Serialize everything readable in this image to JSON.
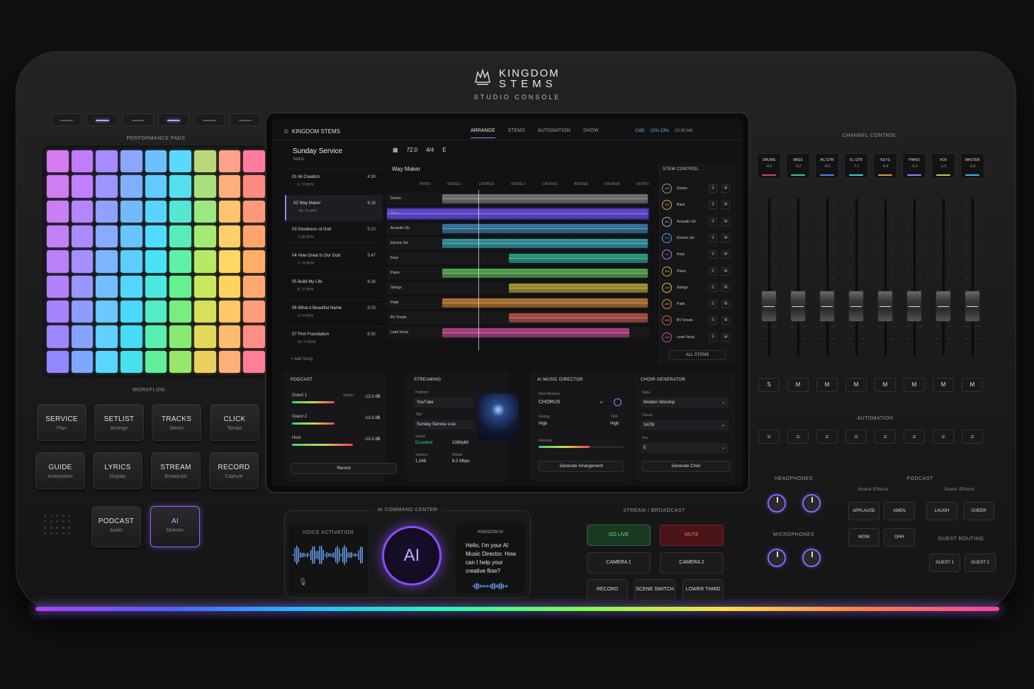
{
  "brand": {
    "name_line1": "KINGDOM",
    "name_line2": "STEMS",
    "subtitle": "STUDIO CONSOLE"
  },
  "labels": {
    "performance_pads": "PERFORMANCE PADS",
    "workflow": "WORKFLOW",
    "channel_control": "CHANNEL CONTROL",
    "automation": "AUTOMATION",
    "headphones": "HEADPHONES",
    "microphones": "MICROPHONES",
    "podcast": "PODCAST",
    "sound_effects": "Sound Effects",
    "guest_effects": "Guest Effects",
    "guest_routing": "GUEST ROUTING",
    "ai_command_center": "AI COMMAND CENTER",
    "stream_broadcast": "STREAM / BROADCAST",
    "voice_activation": "VOICE ACTIVATION"
  },
  "pad_colors": [
    [
      "#d67cf0",
      "#c07cff",
      "#a58cff",
      "#8aa6ff",
      "#6dc0ff",
      "#5ad8ff",
      "#b9d778",
      "#ffa28a",
      "#ff7c9e"
    ],
    [
      "#d07cf2",
      "#c080ff",
      "#9a95ff",
      "#7eb0ff",
      "#62caff",
      "#55e0f0",
      "#a7e07c",
      "#ffb07a",
      "#ff8a80"
    ],
    [
      "#c97ef4",
      "#b585ff",
      "#92a0ff",
      "#72baff",
      "#58d4ff",
      "#55e6d4",
      "#9be880",
      "#ffc470",
      "#ff9878"
    ],
    [
      "#c27ff6",
      "#ab8aff",
      "#88aaff",
      "#66c4ff",
      "#50dcff",
      "#58ecbc",
      "#a4ea74",
      "#ffd06a",
      "#ffa46e"
    ],
    [
      "#ba80f8",
      "#a290ff",
      "#7eb4ff",
      "#5ccdff",
      "#4ce2f6",
      "#5ef0a4",
      "#b6ea66",
      "#ffd864",
      "#ffae66"
    ],
    [
      "#b282fa",
      "#9996ff",
      "#74beff",
      "#52d6ff",
      "#4ce8e0",
      "#66f090",
      "#c8e65e",
      "#ffd262",
      "#ffa870"
    ],
    [
      "#a884fc",
      "#8f9cff",
      "#6ac8ff",
      "#4ad8ff",
      "#52ecc8",
      "#76ee80",
      "#d6e05a",
      "#ffc866",
      "#ff9c7c"
    ],
    [
      "#9e86fe",
      "#86a2ff",
      "#60d0ff",
      "#46dcf8",
      "#5aeeb0",
      "#88ea74",
      "#e2d85a",
      "#ffbc6e",
      "#ff8e88"
    ],
    [
      "#9488ff",
      "#7ca8ff",
      "#58d6ff",
      "#48e0ea",
      "#62ee9a",
      "#98e66c",
      "#ead05e",
      "#ffb078",
      "#ff8094"
    ]
  ],
  "mode_strip": [
    false,
    true,
    false,
    true,
    false,
    false
  ],
  "workflow": [
    {
      "t": "SERVICE",
      "s": "Plan"
    },
    {
      "t": "SETLIST",
      "s": "Arrange"
    },
    {
      "t": "TRACKS",
      "s": "Stems"
    },
    {
      "t": "CLICK",
      "s": "Tempo"
    },
    {
      "t": "GUIDE",
      "s": "Automation"
    },
    {
      "t": "LYRICS",
      "s": "Display"
    },
    {
      "t": "STREAM",
      "s": "Broadcast"
    },
    {
      "t": "RECORD",
      "s": "Capture"
    },
    {
      "t": "PODCAST",
      "s": "Audio"
    },
    {
      "t": "AI",
      "s": "Director"
    }
  ],
  "screen": {
    "app_name": "KINGDOM STEMS",
    "tabs": [
      "ARRANGE",
      "STEMS",
      "AUTOMATION",
      "SHOW"
    ],
    "active_tab": 0,
    "status": {
      "cpu": "CPU 23%",
      "time": "10:30 AM",
      "net": "CMD"
    },
    "transport": {
      "tempo": "72.0",
      "meter": "4/4",
      "key": "E"
    },
    "setlist_title": "Sunday Service",
    "setlist_sub": "Setlist",
    "songs": [
      {
        "nm": "01  All Creation",
        "meta": "E  72 BPM",
        "dur": "4:30"
      },
      {
        "nm": "02  Way Maker",
        "meta": "Bb  76 BPM",
        "dur": "6:18"
      },
      {
        "nm": "03  Goodness of God",
        "meta": "C  68 BPM",
        "dur": "5:22"
      },
      {
        "nm": "04  How Great Is Our God",
        "meta": "D  74 BPM",
        "dur": "5:47"
      },
      {
        "nm": "05  Build My Life",
        "meta": "B  72 BPM",
        "dur": "6:16"
      },
      {
        "nm": "06  What A Beautiful Name",
        "meta": "A  70 BPM",
        "dur": "5:03"
      },
      {
        "nm": "07  Firm Foundation",
        "meta": "Eb  70 BPM",
        "dur": "6:32"
      }
    ],
    "active_song": 1,
    "add_song": "+ Add Song",
    "arrange_song": "Way Maker",
    "sections": [
      "INTRO",
      "VERSE 1",
      "CHORUS",
      "VERSE 2",
      "CHORUS",
      "BRIDGE",
      "CHORUS",
      "OUTRO"
    ],
    "tracks": [
      {
        "name": "Drums",
        "color": "#8a8a8a"
      },
      {
        "name": "Bass",
        "color": "#6b4fd8"
      },
      {
        "name": "Acoustic Gtr",
        "color": "#3d8fc4"
      },
      {
        "name": "Electric Gtr",
        "color": "#36b4c4"
      },
      {
        "name": "Keys",
        "color": "#2fbf9c"
      },
      {
        "name": "Piano",
        "color": "#5fc75a"
      },
      {
        "name": "Strings",
        "color": "#c9b533"
      },
      {
        "name": "Pads",
        "color": "#d9892f"
      },
      {
        "name": "BV Vocals",
        "color": "#d45a4f"
      },
      {
        "name": "Lead Vocal",
        "color": "#d64a9a"
      }
    ],
    "stem_control_title": "STEM CONTROL",
    "stems": [
      {
        "db": "-6.6",
        "name": "Drums",
        "color": "#9a9a9a"
      },
      {
        "db": "-3.2",
        "name": "Bass",
        "color": "#e2a43a"
      },
      {
        "db": "-6.0",
        "name": "Acoustic Gtr",
        "color": "#aaa"
      },
      {
        "db": "-7.1",
        "name": "Electric Gtr",
        "color": "#4aa8ff"
      },
      {
        "db": "-∞",
        "name": "Keys",
        "color": "#b07cff"
      },
      {
        "db": "-5.4",
        "name": "Piano",
        "color": "#e2a43a"
      },
      {
        "db": "-1.0",
        "name": "Strings",
        "color": "#e2c43a"
      },
      {
        "db": "-8.5",
        "name": "Pads",
        "color": "#e28a3a"
      },
      {
        "db": "-2.8",
        "name": "BV Vocals",
        "color": "#e2543a"
      },
      {
        "db": "-1.2",
        "name": "Lead Vocal",
        "color": "#d64a9a"
      }
    ],
    "solo_label": "S",
    "mute_label": "M",
    "all_stems": "ALL STEMS",
    "podcast": {
      "title": "PODCAST",
      "rows": [
        {
          "name": "Guest 1",
          "tag": "Switch",
          "db": "-12.0 dB"
        },
        {
          "name": "Guest 2",
          "tag": "",
          "db": "-12.0 dB"
        },
        {
          "name": "Host",
          "tag": "",
          "db": "-12.0 dB"
        }
      ],
      "record": "Record"
    },
    "streaming": {
      "title": "STREAMING",
      "platform_label": "Platform",
      "platform": "YouTube",
      "title_label": "Title",
      "title_value": "Sunday Service Live",
      "status_label": "Status",
      "status": "Excellent",
      "resolution": "1080p60",
      "viewers_label": "Viewers",
      "viewers": "1,248",
      "bitrate_label": "Bitrate",
      "bitrate": "8.2 Mbps"
    },
    "ai_director": {
      "title": "AI MUSIC DIRECTOR",
      "next_label": "Next Moment",
      "next": "CHORUS",
      "energy_label": "Energy",
      "energy": "High",
      "energy_right": "High",
      "energy_right_label": "N/A",
      "intensity_label": "Intensity",
      "intensity_level": 0.6,
      "button": "Generate Arrangement"
    },
    "choir": {
      "title": "CHOIR GENERATOR",
      "style_label": "Style",
      "style": "Modern Worship",
      "voices_label": "Voices",
      "voices": "SATB",
      "key_label": "Key",
      "key": "E",
      "button": "Generate Choir"
    }
  },
  "ai_center": {
    "orb": "AI",
    "msg_title": "KINGDOM AI",
    "msg": "Hello, I'm your AI Music Director. How can I help your creative flow?"
  },
  "stream_buttons": {
    "go_live": "GO LIVE",
    "mute": "MUTE",
    "camera1": "CAMERA 1",
    "camera2": "CAMERA 2",
    "record": "RECORD",
    "scene": "SCENE SWITCH",
    "lower": "LOWER THIRD"
  },
  "channels": [
    {
      "name": "DRUMS",
      "db": "-6.6",
      "color": "#e04a4a"
    },
    {
      "name": "BASS",
      "db": "-3.2",
      "color": "#3ad17a"
    },
    {
      "name": "AC GTR",
      "db": "-6.0",
      "color": "#3a8aff"
    },
    {
      "name": "EL GTR",
      "db": "-7.1",
      "color": "#3acfe0"
    },
    {
      "name": "KEYS",
      "db": "-5.4",
      "color": "#e09a3a"
    },
    {
      "name": "PIANO",
      "db": "-5.4",
      "color": "#a07cff"
    },
    {
      "name": "VOX",
      "db": "-1.2",
      "color": "#e0c43a"
    },
    {
      "name": "MASTER",
      "db": "-0.8",
      "color": "#3ab8ff"
    }
  ],
  "channel_buttons": [
    "S",
    "M",
    "M",
    "M",
    "M",
    "M",
    "M",
    "M"
  ],
  "podcast_fx": [
    "APPLAUSE",
    "AMEN",
    "LAUGH",
    "CHEER",
    "WOW",
    "OHH"
  ],
  "guest_routing": [
    "GUEST 1",
    "GUEST 2"
  ]
}
